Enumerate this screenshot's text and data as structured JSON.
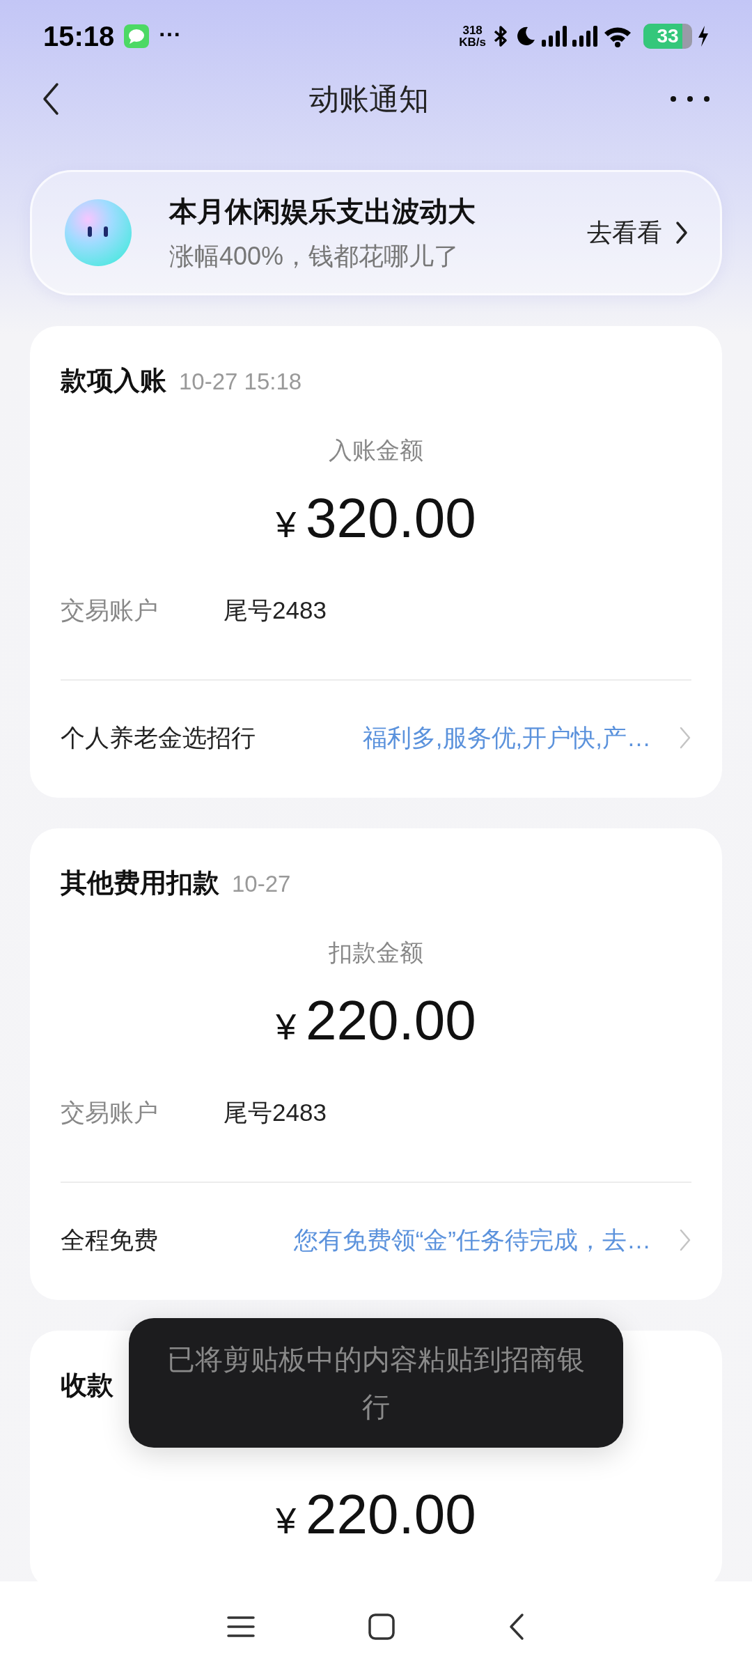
{
  "status_bar": {
    "time": "15:18",
    "more": "···",
    "network_speed": {
      "value": "318",
      "unit": "KB/s"
    },
    "battery": "33"
  },
  "header": {
    "title": "动账通知"
  },
  "banner": {
    "title": "本月休闲娱乐支出波动大",
    "subtitle": "涨幅400%，钱都花哪儿了",
    "action": "去看看"
  },
  "cards": [
    {
      "title": "款项入账",
      "time": "10-27 15:18",
      "amount_label": "入账金额",
      "currency": "¥",
      "amount": "320.00",
      "account_label": "交易账户",
      "account": "尾号2483",
      "promo": {
        "label": "个人养老金选招行",
        "text": "福利多,服务优,开户快,产…"
      }
    },
    {
      "title": "其他费用扣款",
      "time": "10-27",
      "amount_label": "扣款金额",
      "currency": "¥",
      "amount": "220.00",
      "account_label": "交易账户",
      "account": "尾号2483",
      "promo": {
        "label": "全程免费",
        "text": "您有免费领“金”任务待完成，去…"
      }
    },
    {
      "title": "收款",
      "currency": "¥",
      "amount": "220.00"
    }
  ],
  "toast": {
    "text": "已将剪贴板中的内容粘贴到招商银行"
  }
}
